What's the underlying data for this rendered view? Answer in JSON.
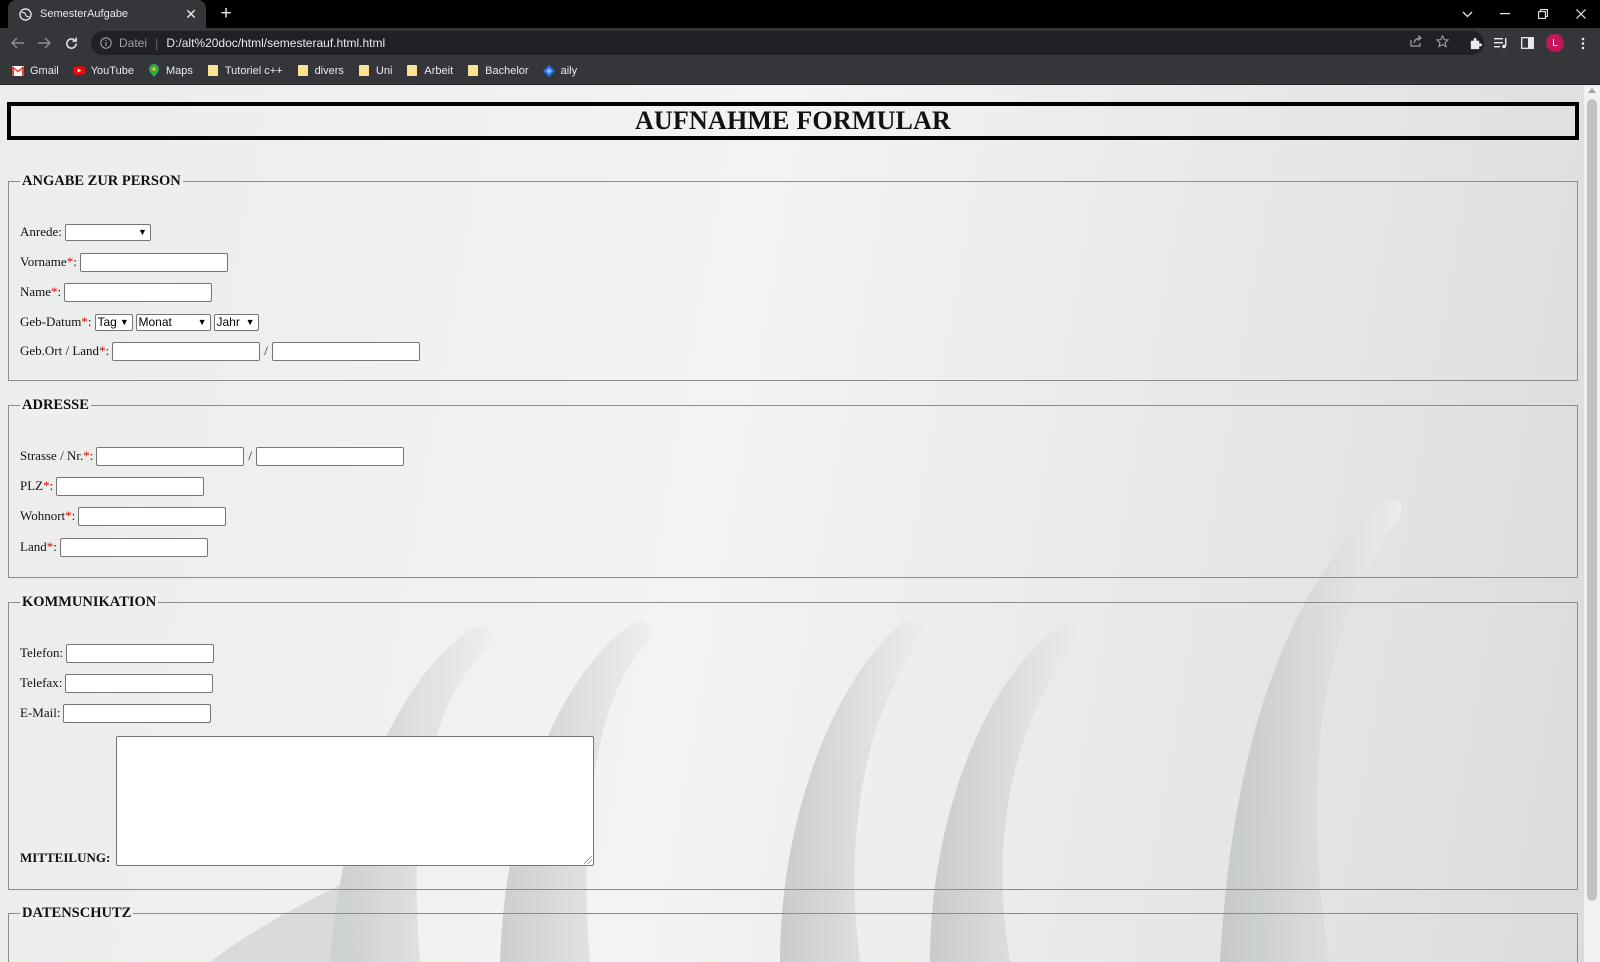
{
  "browser": {
    "tab_title": "SemesterAufgabe",
    "new_tab_symbol": "+",
    "url_scheme": "Datei",
    "url": "D:/alt%20doc/html/semesterauf.html.html",
    "avatar_letter": "L",
    "bookmarks": [
      {
        "label": "Gmail",
        "icon": "gmail-icon"
      },
      {
        "label": "YouTube",
        "icon": "youtube-icon"
      },
      {
        "label": "Maps",
        "icon": "maps-icon"
      },
      {
        "label": "Tutoriel c++",
        "icon": "folder-icon"
      },
      {
        "label": "divers",
        "icon": "folder-icon"
      },
      {
        "label": "Uni",
        "icon": "folder-icon"
      },
      {
        "label": "Arbeit",
        "icon": "folder-icon"
      },
      {
        "label": "Bachelor",
        "icon": "folder-icon"
      },
      {
        "label": "aily",
        "icon": "aily-icon"
      }
    ]
  },
  "form": {
    "title": "AUFNAHME FORMULAR",
    "required_mark": "*",
    "slash": "/",
    "person": {
      "legend": "ANGABE ZUR PERSON",
      "anrede_label": "Anrede:",
      "anrede_value": "",
      "vorname_label": "Vorname ",
      "name_label": "Name",
      "gebdatum_label": "Geb-Datum",
      "day_value": "Tag",
      "month_value": "Monat",
      "year_value": "Jahr",
      "gebort_label": "Geb.Ort / Land"
    },
    "address": {
      "legend": "ADRESSE",
      "strasse_label": "Strasse / Nr.",
      "plz_label": "PLZ",
      "wohnort_label": "Wohnort",
      "land_label": "Land"
    },
    "communication": {
      "legend": "KOMMUNIKATION",
      "telefon_label": "Telefon:",
      "telefax_label": "Telefax:",
      "email_label": "E-Mail:",
      "message_label": "MITTEILUNG:"
    },
    "privacy": {
      "legend": "DATENSCHUTZ"
    }
  },
  "colors": {
    "required": "#e00000",
    "chrome_bg": "#35363a",
    "tabstrip_bg": "#000000"
  }
}
